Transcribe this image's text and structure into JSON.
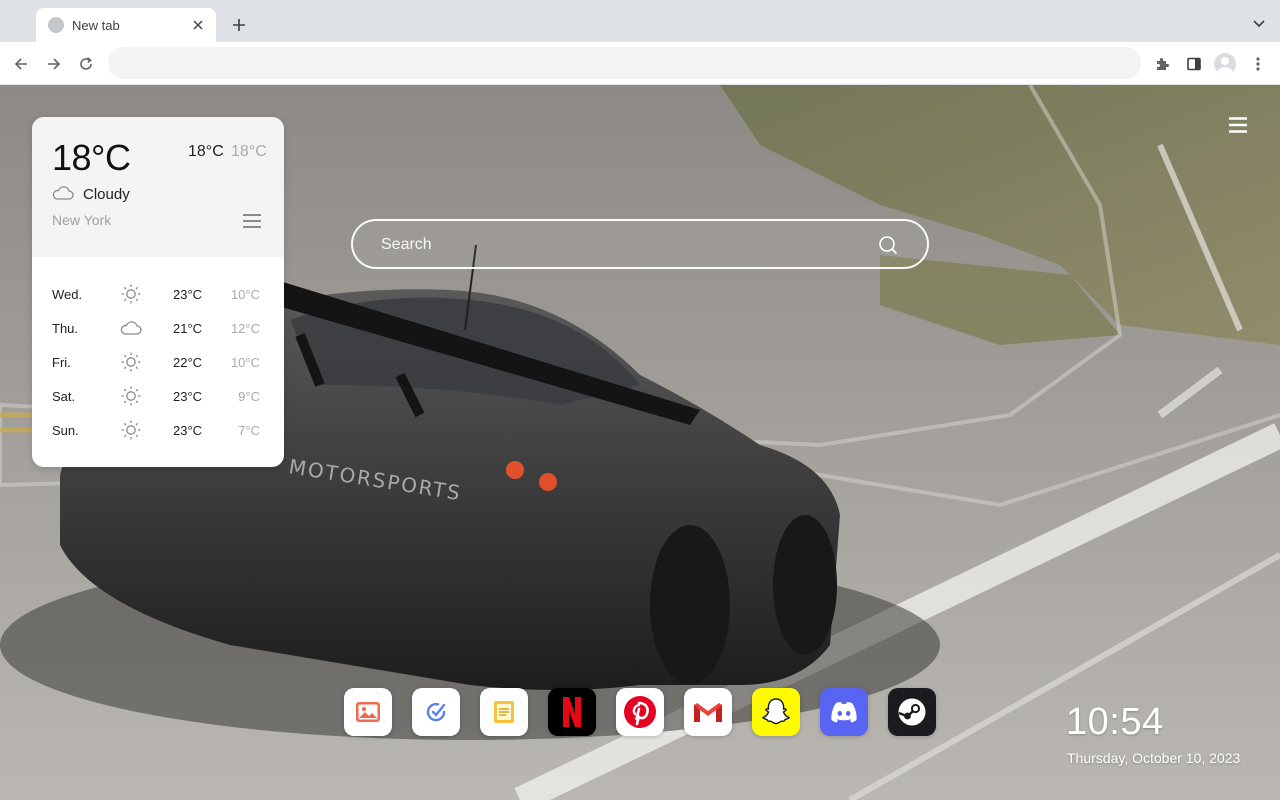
{
  "browser": {
    "tab_title": "New tab",
    "omnibox_value": ""
  },
  "icons": {
    "tab_close": "close-icon",
    "new_tab": "plus-icon",
    "tab_search": "chevron-down-icon",
    "back": "arrow-left-icon",
    "forward": "arrow-right-icon",
    "reload": "reload-icon",
    "extensions": "puzzle-icon",
    "side_panel": "side-panel-icon",
    "profile": "avatar-icon",
    "chrome_menu": "kebab-icon",
    "page_menu": "hamburger-icon",
    "search": "search-icon"
  },
  "weather": {
    "current_temp": "18°C",
    "high": "18°C",
    "low": "18°C",
    "condition": "Cloudy",
    "condition_icon": "cloud-icon",
    "city": "New York",
    "forecast": [
      {
        "day": "Wed.",
        "icon": "sun-icon",
        "high": "23°C",
        "low": "10°C"
      },
      {
        "day": "Thu.",
        "icon": "cloud-icon",
        "high": "21°C",
        "low": "12°C"
      },
      {
        "day": "Fri.",
        "icon": "sun-icon",
        "high": "22°C",
        "low": "10°C"
      },
      {
        "day": "Sat.",
        "icon": "sun-icon",
        "high": "23°C",
        "low": "9°C"
      },
      {
        "day": "Sun.",
        "icon": "sun-icon",
        "high": "23°C",
        "low": "7°C"
      }
    ]
  },
  "search": {
    "placeholder": "Search"
  },
  "car_livery": "MOTORSPORTS",
  "dock": [
    {
      "name": "Photos",
      "icon": "photos-icon",
      "bg": "#ffffff"
    },
    {
      "name": "Tasks",
      "icon": "tasks-icon",
      "bg": "#ffffff"
    },
    {
      "name": "Notes",
      "icon": "notes-icon",
      "bg": "#ffffff"
    },
    {
      "name": "Netflix",
      "icon": "netflix-icon",
      "bg": "#000000"
    },
    {
      "name": "Pinterest",
      "icon": "pinterest-icon",
      "bg": "#ffffff"
    },
    {
      "name": "Gmail",
      "icon": "gmail-icon",
      "bg": "#ffffff"
    },
    {
      "name": "Snapchat",
      "icon": "snapchat-icon",
      "bg": "#fffc00"
    },
    {
      "name": "Discord",
      "icon": "discord-icon",
      "bg": "#5865f2"
    },
    {
      "name": "Steam",
      "icon": "steam-icon",
      "bg": "#1b1b1f"
    }
  ],
  "clock": {
    "time": "10:54",
    "date": "Thursday, October 10, 2023"
  },
  "colors": {
    "chrome_bg": "#dee1e6",
    "netflix_red": "#e50914",
    "pinterest_red": "#e60023",
    "discord_blue": "#5865f2",
    "snapchat_yellow": "#fffc00"
  }
}
